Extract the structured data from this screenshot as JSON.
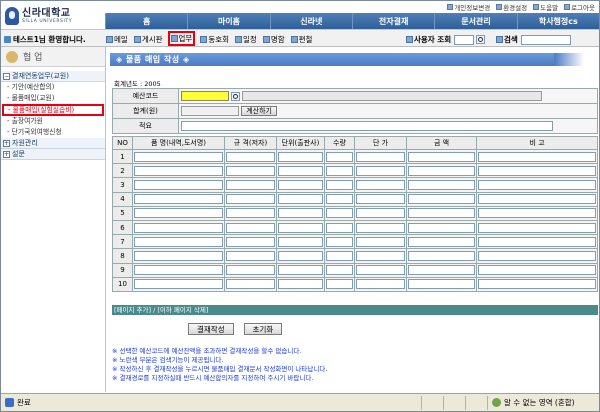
{
  "header": {
    "logo_kr": "신라대학교",
    "logo_en": "SILLA UNIVERSITY",
    "top_links": [
      "개인정보변경",
      "환경설정",
      "도움말",
      "로그아웃"
    ],
    "nav": [
      "홈",
      "마이홈",
      "신라넷",
      "전자결재",
      "문서관리",
      "학사행정cs"
    ]
  },
  "subbar": {
    "welcome": "테스트1님 환영합니다.",
    "tools": [
      "메일",
      "게시판",
      "업무",
      "동호회",
      "일정",
      "명함",
      "편철"
    ],
    "active_tool": "업무",
    "user_search_label": "사용자 조회",
    "search_label": "검색"
  },
  "sidebar": {
    "title": "협 업",
    "sections": [
      {
        "label": "결재연동업무(교원)",
        "expanded": "−"
      },
      {
        "label": "자원관리",
        "expanded": "+"
      },
      {
        "label": "설문",
        "expanded": "+"
      }
    ],
    "items": [
      "기안(예산합의)",
      "물품매입(교원)",
      "물품매입(실험실습비)",
      "출장여가원",
      "단기국외여행신청"
    ],
    "active_item": "물품매입(실험실습비)"
  },
  "form": {
    "title": "◈ 물품 매입 작성 ◈",
    "year_label": "회계년도 : 2005",
    "budget_code_label": "예산코드",
    "total_label": "합계(원)",
    "calc_button": "계산하기",
    "remarks_label": "적요"
  },
  "table": {
    "headers": [
      "NO",
      "품 명(내역,도서명)",
      "규 격(저자)",
      "단위(출판사)",
      "수량",
      "단 가",
      "금 액",
      "비 고"
    ],
    "rows": [
      "1",
      "2",
      "3",
      "4",
      "5",
      "6",
      "7",
      "8",
      "9",
      "10"
    ]
  },
  "pager": "[페이지 추가] / [이하 페이지 삭제]",
  "actions": {
    "submit": "결재작성",
    "reset": "초기화"
  },
  "notes": [
    "※ 선택한 예산코드에 예산잔액을 초과하면 결재작성을 할수 없습니다.",
    "※ 노란색 부분은 검색기능이 제공됩니다.",
    "※ 작성하신 후 결재작성을 누르시면 물품매입 결재문서 작성화면이 나타납니다.",
    "※ 결재경로를 지정하실때 반드시 예산합의자를 지정하여 주시기 바랍니다."
  ],
  "statusbar": {
    "left": "완료",
    "zone": "알 수 없는 영역 (혼합)"
  }
}
